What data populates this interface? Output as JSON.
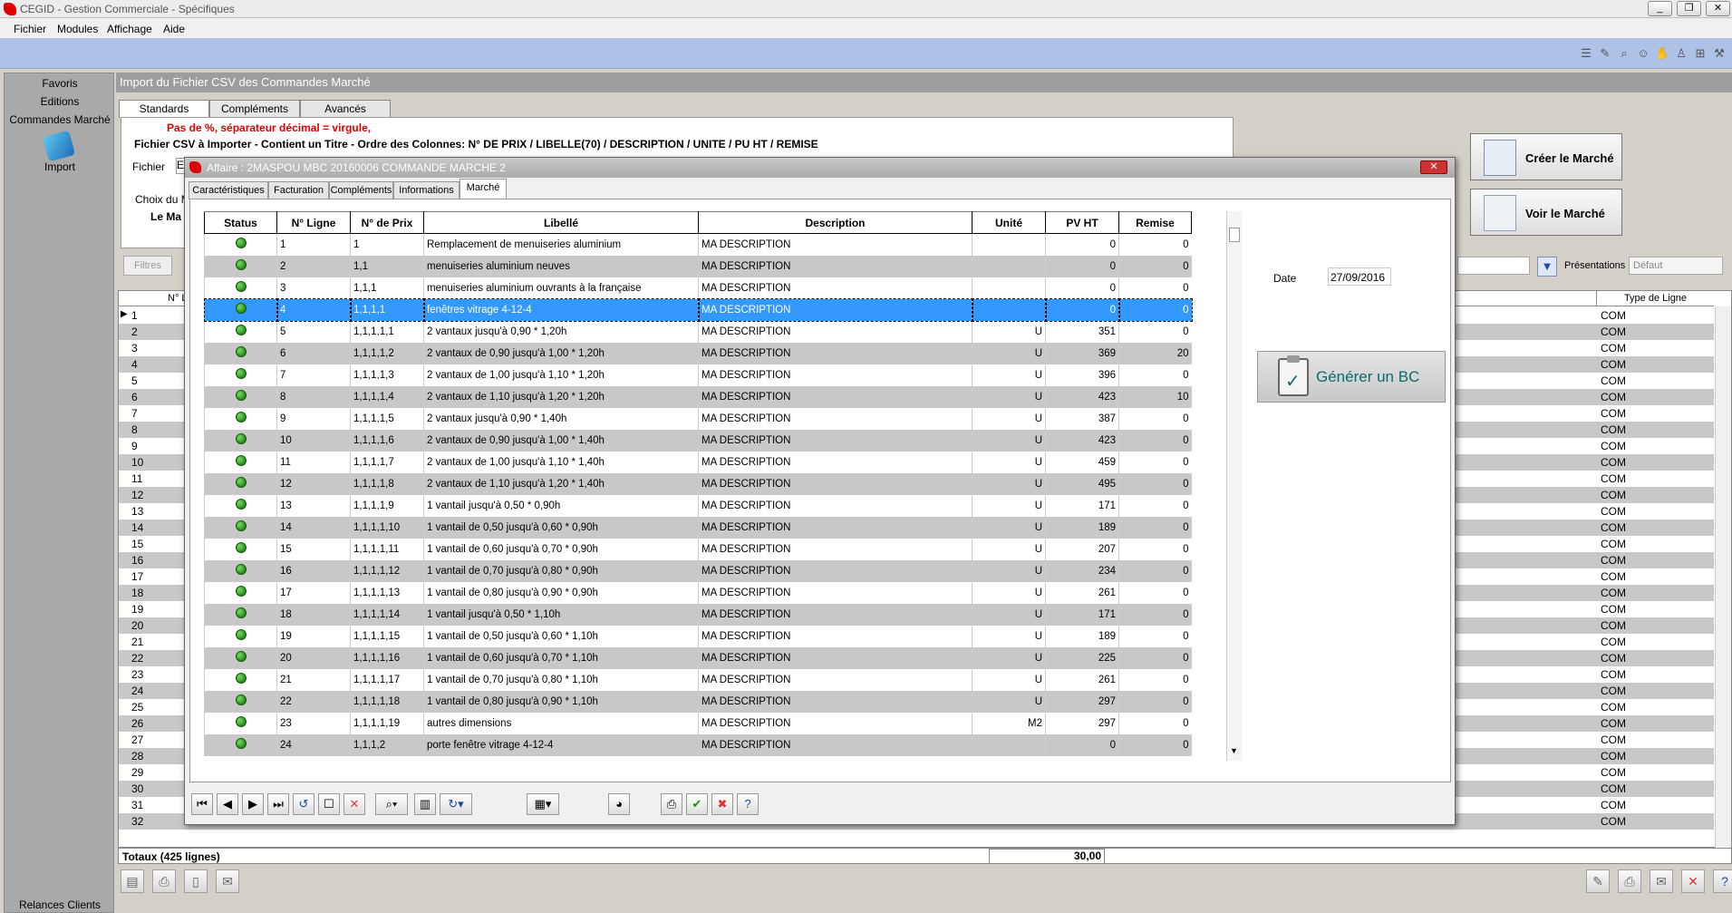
{
  "app": {
    "title": "CEGID - Gestion Commerciale - Spécifiques",
    "window_buttons": [
      "_",
      "❐",
      "✕"
    ]
  },
  "menu": [
    "Fichier",
    "Modules",
    "Affichage",
    "Aide"
  ],
  "left_panel": {
    "items": [
      "Favoris",
      "Editions",
      "Commandes Marché"
    ],
    "active_module": "Import",
    "bottom": "Relances Clients"
  },
  "main": {
    "header": "Import du Fichier CSV des Commandes Marché",
    "tabs": [
      "Standards",
      "Compléments",
      "Avancés"
    ],
    "warning": "Pas de %, séparateur décimal = virgule,",
    "instructions": "Fichier CSV à Importer - Contient un Titre - Ordre des Colonnes: N° DE PRIX / LIBELLE(70) / DESCRIPTION / UNITE / PU HT / REMISE",
    "fichier_label": "Fichier",
    "fichier_value": "E",
    "choix_label": "Choix du M",
    "le_ma": "Le Ma",
    "btn_creer": "Créer le Marché",
    "btn_voir": "Voir le Marché",
    "filtres": "Filtres",
    "presentations_label": "Présentations",
    "presentations_value": "Défaut",
    "grid_col_n": "N° L",
    "grid_col_type": "Type de Ligne",
    "row_numbers": [
      "1",
      "2",
      "3",
      "4",
      "5",
      "6",
      "7",
      "8",
      "9",
      "10",
      "11",
      "12",
      "13",
      "14",
      "15",
      "16",
      "17",
      "18",
      "19",
      "20",
      "21",
      "22",
      "23",
      "24",
      "25",
      "26",
      "27",
      "28",
      "29",
      "30",
      "31",
      "32"
    ],
    "type_value": "COM",
    "totals_label": "Totaux (425 lignes)",
    "totals_value": "30,00"
  },
  "dialog": {
    "title": "Affaire : 2MASPOU MBC 20160006 COMMANDE MARCHE 2",
    "tabs": [
      "Caractéristiques",
      "Facturation",
      "Compléments",
      "Informations",
      "Marché"
    ],
    "date_label": "Date",
    "date_value": "27/09/2016",
    "gen_bc": "Générer un BC",
    "columns": [
      "Status",
      "N° Ligne",
      "N° de Prix",
      "Libellé",
      "Description",
      "Unité",
      "PV HT",
      "Remise"
    ],
    "rows": [
      {
        "n": "1",
        "prix": "1",
        "lib": "Remplacement de menuiseries aluminium",
        "desc": "MA DESCRIPTION",
        "u": "",
        "pv": "0",
        "rem": "0"
      },
      {
        "n": "2",
        "prix": "1,1",
        "lib": "menuiseries aluminium neuves",
        "desc": "MA DESCRIPTION",
        "u": "",
        "pv": "0",
        "rem": "0"
      },
      {
        "n": "3",
        "prix": "1,1,1",
        "lib": "menuiseries aluminium ouvrants à la française",
        "desc": "MA DESCRIPTION",
        "u": "",
        "pv": "0",
        "rem": "0"
      },
      {
        "n": "4",
        "prix": "1,1,1,1",
        "lib": "fenêtres vitrage 4-12-4",
        "desc": "MA DESCRIPTION",
        "u": "",
        "pv": "0",
        "rem": "0"
      },
      {
        "n": "5",
        "prix": "1,1,1,1,1",
        "lib": "2 vantaux jusqu'à 0,90 * 1,20h",
        "desc": "MA DESCRIPTION",
        "u": "U",
        "pv": "351",
        "rem": "0"
      },
      {
        "n": "6",
        "prix": "1,1,1,1,2",
        "lib": "2 vantaux de 0,90 jusqu'à 1,00 * 1,20h",
        "desc": "MA DESCRIPTION",
        "u": "U",
        "pv": "369",
        "rem": "20"
      },
      {
        "n": "7",
        "prix": "1,1,1,1,3",
        "lib": "2 vantaux de 1,00 jusqu'à 1,10 * 1,20h",
        "desc": "MA DESCRIPTION",
        "u": "U",
        "pv": "396",
        "rem": "0"
      },
      {
        "n": "8",
        "prix": "1,1,1,1,4",
        "lib": "2 vantaux de 1,10 jusqu'à 1,20 * 1,20h",
        "desc": "MA DESCRIPTION",
        "u": "U",
        "pv": "423",
        "rem": "10"
      },
      {
        "n": "9",
        "prix": "1,1,1,1,5",
        "lib": "2 vantaux jusqu'à 0,90 * 1,40h",
        "desc": "MA DESCRIPTION",
        "u": "U",
        "pv": "387",
        "rem": "0"
      },
      {
        "n": "10",
        "prix": "1,1,1,1,6",
        "lib": "2 vantaux de 0,90 jusqu'à 1,00 * 1,40h",
        "desc": "MA DESCRIPTION",
        "u": "U",
        "pv": "423",
        "rem": "0"
      },
      {
        "n": "11",
        "prix": "1,1,1,1,7",
        "lib": "2 vantaux de 1,00 jusqu'à 1,10 * 1,40h",
        "desc": "MA DESCRIPTION",
        "u": "U",
        "pv": "459",
        "rem": "0"
      },
      {
        "n": "12",
        "prix": "1,1,1,1,8",
        "lib": "2 vantaux de 1,10 jusqu'à 1,20 * 1,40h",
        "desc": "MA DESCRIPTION",
        "u": "U",
        "pv": "495",
        "rem": "0"
      },
      {
        "n": "13",
        "prix": "1,1,1,1,9",
        "lib": "1 vantail jusqu'à 0,50 * 0,90h",
        "desc": "MA DESCRIPTION",
        "u": "U",
        "pv": "171",
        "rem": "0"
      },
      {
        "n": "14",
        "prix": "1,1,1,1,10",
        "lib": "1 vantail de 0,50 jusqu'à 0,60 *  0,90h",
        "desc": "MA DESCRIPTION",
        "u": "U",
        "pv": "189",
        "rem": "0"
      },
      {
        "n": "15",
        "prix": "1,1,1,1,11",
        "lib": "1 vantail de 0,60 jusqu'à 0,70 *  0,90h",
        "desc": "MA DESCRIPTION",
        "u": "U",
        "pv": "207",
        "rem": "0"
      },
      {
        "n": "16",
        "prix": "1,1,1,1,12",
        "lib": "1 vantail de 0,70 jusqu'à 0,80 *  0,90h",
        "desc": "MA DESCRIPTION",
        "u": "U",
        "pv": "234",
        "rem": "0"
      },
      {
        "n": "17",
        "prix": "1,1,1,1,13",
        "lib": "1 vantail de 0,80 jusqu'à 0,90 *  0,90h",
        "desc": "MA DESCRIPTION",
        "u": "U",
        "pv": "261",
        "rem": "0"
      },
      {
        "n": "18",
        "prix": "1,1,1,1,14",
        "lib": "1 vantail jusqu'à 0,50 * 1,10h",
        "desc": "MA DESCRIPTION",
        "u": "U",
        "pv": "171",
        "rem": "0"
      },
      {
        "n": "19",
        "prix": "1,1,1,1,15",
        "lib": "1 vantail de 0,50 jusqu'à 0,60 *  1,10h",
        "desc": "MA DESCRIPTION",
        "u": "U",
        "pv": "189",
        "rem": "0"
      },
      {
        "n": "20",
        "prix": "1,1,1,1,16",
        "lib": "1 vantail de 0,60 jusqu'à 0,70 *  1,10h",
        "desc": "MA DESCRIPTION",
        "u": "U",
        "pv": "225",
        "rem": "0"
      },
      {
        "n": "21",
        "prix": "1,1,1,1,17",
        "lib": "1 vantail de 0,70 jusqu'à 0,80 *  1,10h",
        "desc": "MA DESCRIPTION",
        "u": "U",
        "pv": "261",
        "rem": "0"
      },
      {
        "n": "22",
        "prix": "1,1,1,1,18",
        "lib": "1 vantail de 0,80 jusqu'à 0,90 *  1,10h",
        "desc": "MA DESCRIPTION",
        "u": "U",
        "pv": "297",
        "rem": "0"
      },
      {
        "n": "23",
        "prix": "1,1,1,1,19",
        "lib": "autres dimensions",
        "desc": "MA DESCRIPTION",
        "u": "M2",
        "pv": "297",
        "rem": "0"
      },
      {
        "n": "24",
        "prix": "1,1,1,2",
        "lib": "porte fenêtre vitrage 4-12-4",
        "desc": "MA DESCRIPTION",
        "u": "",
        "pv": "0",
        "rem": "0"
      }
    ]
  },
  "colors": {
    "accent": "#3399ff",
    "toolstrip": "#aec2e8",
    "status_green": "#2a9a1a",
    "warning_red": "#e00000"
  }
}
